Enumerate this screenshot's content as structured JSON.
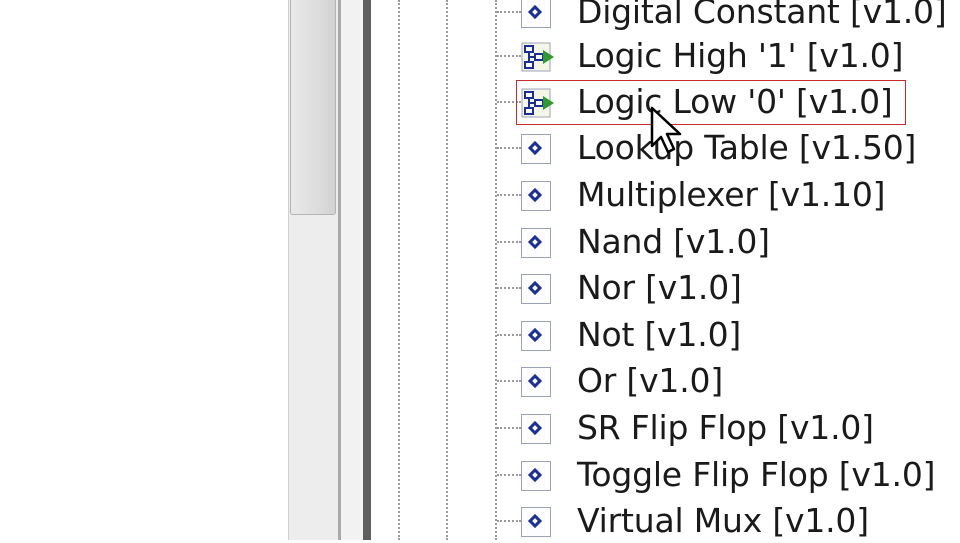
{
  "tree": {
    "items": [
      {
        "label": "Digital Constant [v1.0]",
        "icon": "block-icon"
      },
      {
        "label": "Logic High '1' [v1.0]",
        "icon": "flow-block-icon"
      },
      {
        "label": "Logic Low '0' [v1.0]",
        "icon": "flow-block-icon",
        "selected": true
      },
      {
        "label": "Lookup Table [v1.50]",
        "icon": "block-icon"
      },
      {
        "label": "Multiplexer [v1.10]",
        "icon": "block-icon"
      },
      {
        "label": "Nand [v1.0]",
        "icon": "block-icon"
      },
      {
        "label": "Nor [v1.0]",
        "icon": "block-icon"
      },
      {
        "label": "Not [v1.0]",
        "icon": "block-icon"
      },
      {
        "label": "Or [v1.0]",
        "icon": "block-icon"
      },
      {
        "label": "SR Flip Flop [v1.0]",
        "icon": "block-icon"
      },
      {
        "label": "Toggle Flip Flop [v1.0]",
        "icon": "block-icon"
      },
      {
        "label": "Virtual Mux [v1.0]",
        "icon": "block-icon"
      }
    ]
  },
  "colors": {
    "selection_border": "#c62c2c",
    "icon_blue": "#1b2f9a",
    "icon_green": "#2e9a2e"
  }
}
